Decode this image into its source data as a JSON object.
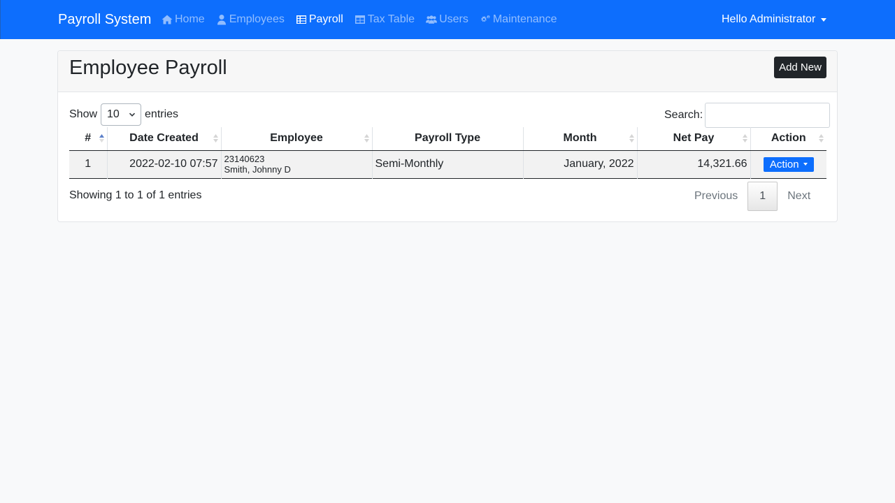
{
  "navbar": {
    "brand": "Payroll System",
    "items": [
      {
        "label": "Home",
        "icon": "home-icon"
      },
      {
        "label": "Employees",
        "icon": "user-icon"
      },
      {
        "label": "Payroll",
        "icon": "table-list-icon",
        "active": true
      },
      {
        "label": "Tax Table",
        "icon": "table-icon"
      },
      {
        "label": "Users",
        "icon": "users-icon"
      },
      {
        "label": "Maintenance",
        "icon": "cogs-icon"
      }
    ],
    "user_menu": "Hello Administrator"
  },
  "page": {
    "title": "Employee Payroll",
    "add_new": "Add New"
  },
  "table_controls": {
    "show_label": "Show",
    "entries_value": "10",
    "entries_label": "entries",
    "search_label": "Search:",
    "search_value": ""
  },
  "table": {
    "columns": [
      "#",
      "Date Created",
      "Employee",
      "Payroll Type",
      "Month",
      "Net Pay",
      "Action"
    ],
    "rows": [
      {
        "num": "1",
        "date_created": "2022-02-10 07:57",
        "employee_code": "23140623",
        "employee_name": "Smith, Johnny D",
        "payroll_type": "Semi-Monthly",
        "month": "January, 2022",
        "net_pay": "14,321.66",
        "action": "Action"
      }
    ]
  },
  "footer": {
    "info": "Showing 1 to 1 of 1 entries",
    "previous": "Previous",
    "current_page": "1",
    "next": "Next"
  },
  "colors": {
    "primary": "#0d6efd",
    "dark": "#212529",
    "background": "#f8f9fa"
  }
}
